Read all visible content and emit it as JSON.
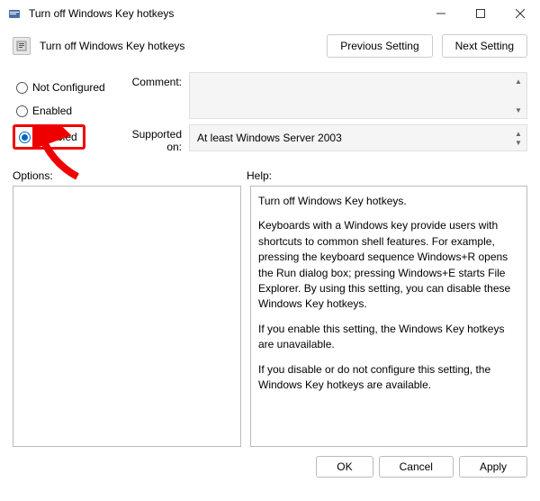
{
  "window": {
    "title": "Turn off Windows Key hotkeys"
  },
  "header": {
    "title": "Turn off Windows Key hotkeys",
    "prev_btn": "Previous Setting",
    "next_btn": "Next Setting"
  },
  "radios": {
    "not_configured": "Not Configured",
    "enabled": "Enabled",
    "disabled": "Disabled",
    "selected": "disabled"
  },
  "fields": {
    "comment_label": "Comment:",
    "comment_value": "",
    "supported_label": "Supported on:",
    "supported_value": "At least Windows Server 2003"
  },
  "panels": {
    "options_label": "Options:",
    "help_label": "Help:",
    "help_paragraphs": [
      "Turn off Windows Key hotkeys.",
      "Keyboards with a Windows key provide users with shortcuts to common shell features. For example, pressing the keyboard sequence Windows+R opens the Run dialog box; pressing Windows+E starts File Explorer. By using this setting, you can disable these Windows Key hotkeys.",
      "If you enable this setting, the Windows Key hotkeys are unavailable.",
      "If you disable or do not configure this setting, the Windows Key hotkeys are available."
    ]
  },
  "buttons": {
    "ok": "OK",
    "cancel": "Cancel",
    "apply": "Apply"
  }
}
